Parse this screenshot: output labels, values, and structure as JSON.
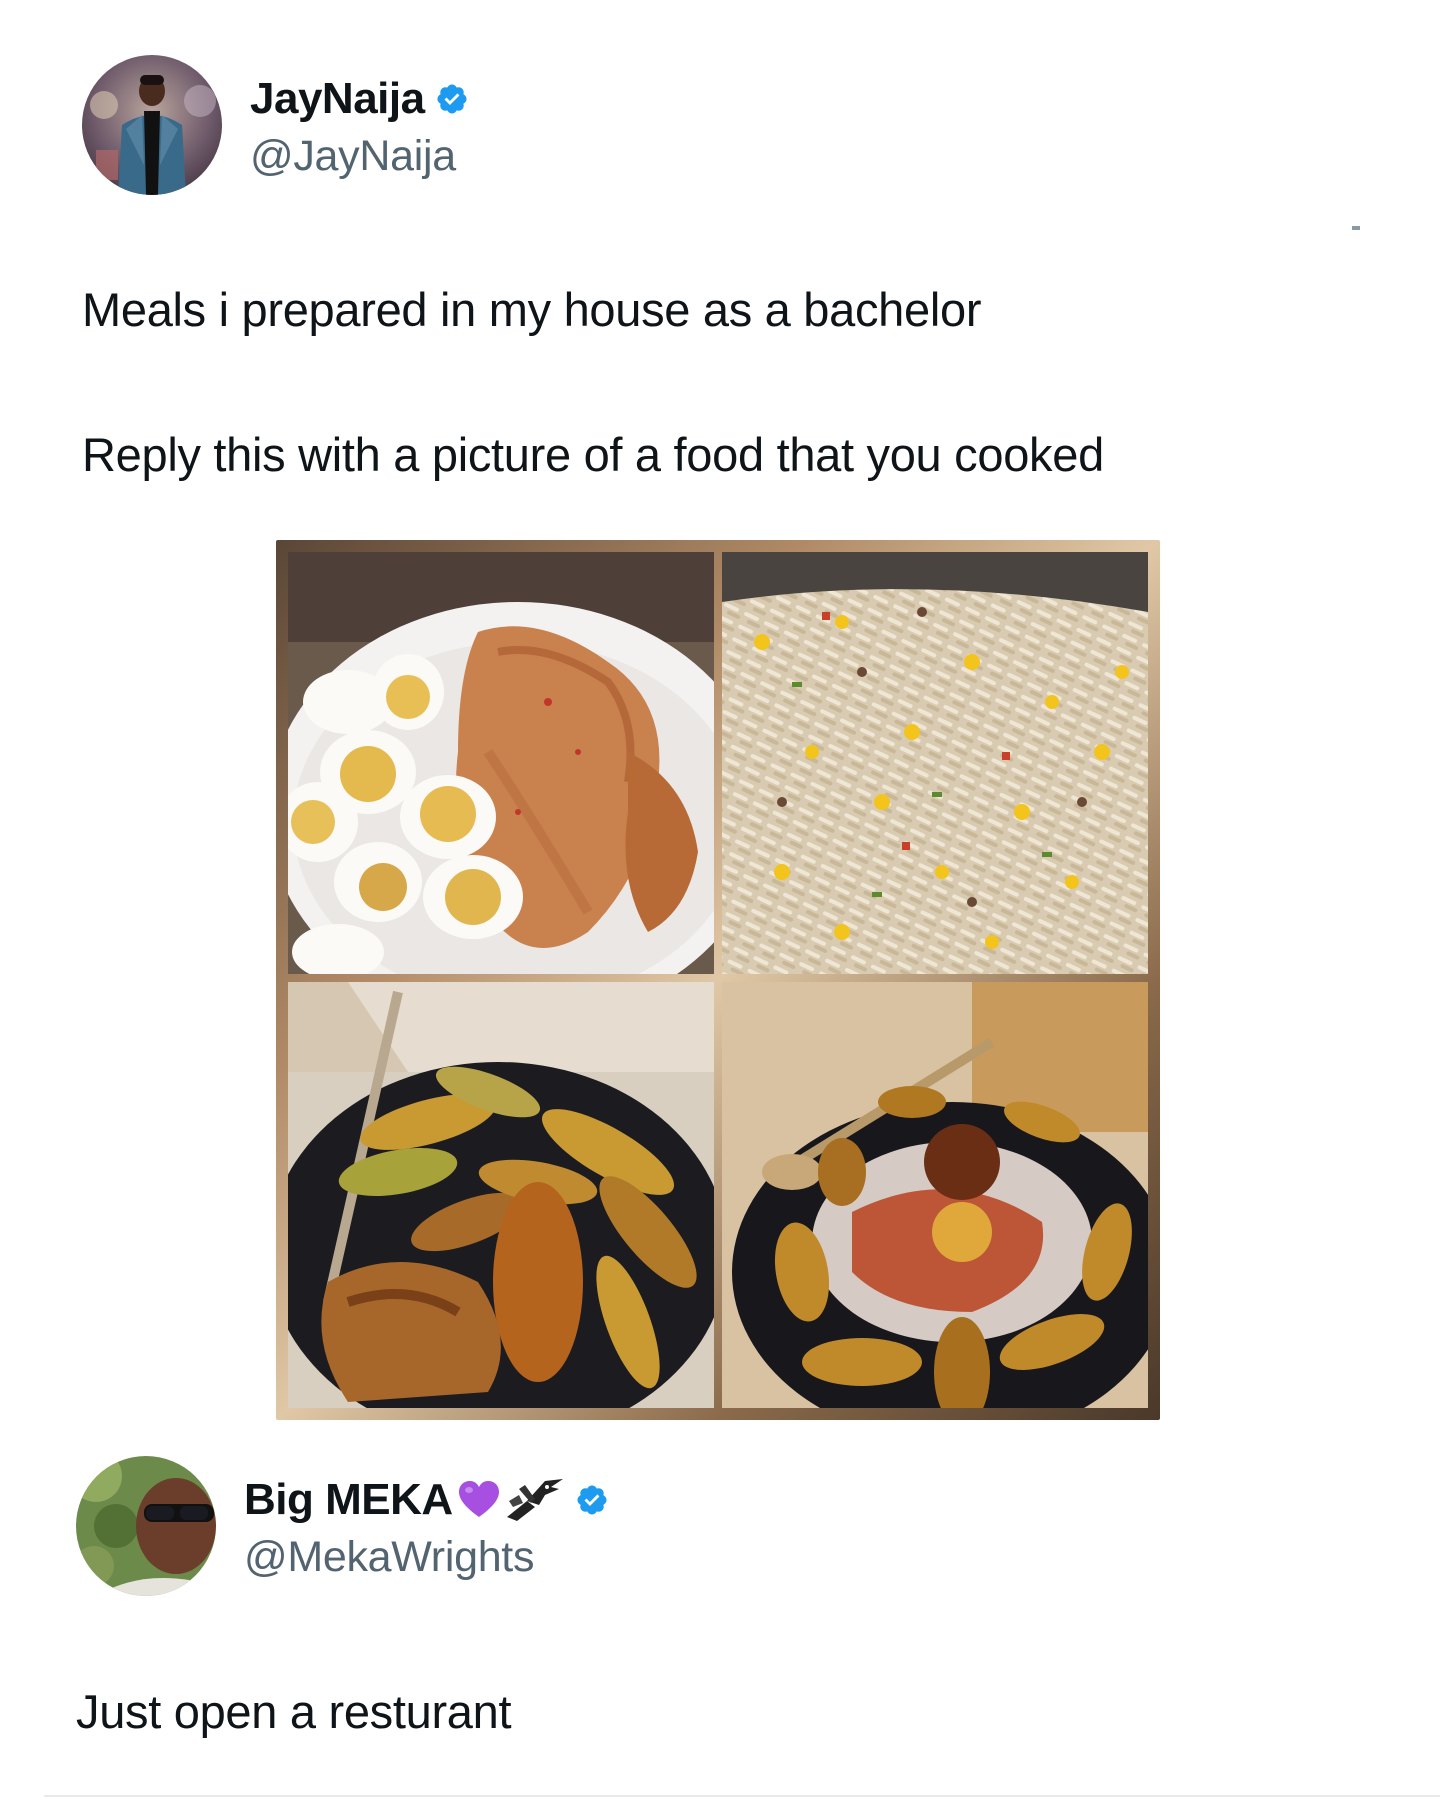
{
  "original_tweet": {
    "display_name": "JayNaija",
    "handle": "@JayNaija",
    "verified": true,
    "text_line1": "Meals i prepared in my house as a bachelor",
    "text_line2": "Reply this with a picture of a food that you cooked",
    "media": [
      {
        "icon": "photo-eggs-and-chicken"
      },
      {
        "icon": "photo-fried-rice"
      },
      {
        "icon": "photo-plantain-and-stew"
      },
      {
        "icon": "photo-swallow-plantain-egg-sauce"
      }
    ]
  },
  "reply_tweet": {
    "display_name": "Big MEKA",
    "name_emojis": [
      "purple-heart-icon",
      "eagle-icon"
    ],
    "handle": "@MekaWrights",
    "verified": true,
    "text": "Just open a resturant"
  },
  "colors": {
    "verified_blue": "#1d9bf0",
    "handle_gray": "#536471",
    "text": "#0f1419",
    "purple_heart": "#a64fe0"
  }
}
